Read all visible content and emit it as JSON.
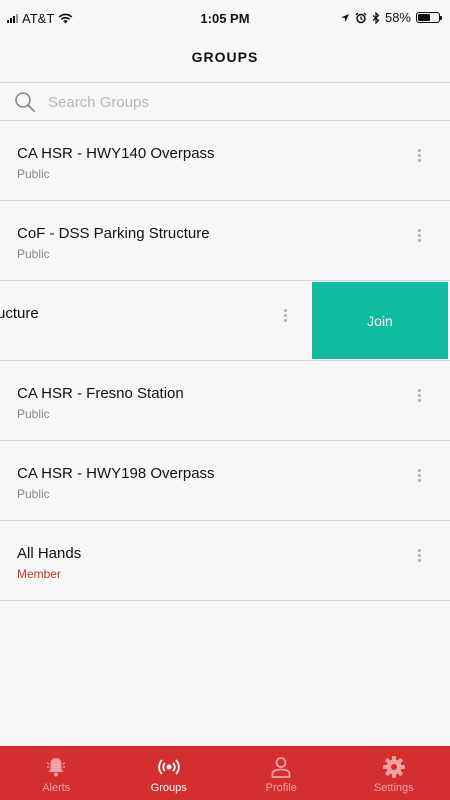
{
  "status_bar": {
    "carrier": "AT&T",
    "time": "1:05 PM",
    "battery_percent": "58%",
    "battery_level": 0.58,
    "icons": [
      "signal-icon",
      "wifi-icon",
      "location-icon",
      "alarm-icon",
      "bluetooth-icon",
      "battery-icon"
    ]
  },
  "header": {
    "title": "GROUPS"
  },
  "search": {
    "placeholder": "Search Groups",
    "value": ""
  },
  "groups": [
    {
      "name": "CA HSR - HWY140 Overpass",
      "type": "Public"
    },
    {
      "name": "CoF - DSS Parking Structure",
      "type": "Public"
    },
    {
      "name": "ructure",
      "type": "",
      "swiped": true,
      "action": "Join"
    },
    {
      "name": "CA HSR - Fresno Station",
      "type": "Public"
    },
    {
      "name": "CA HSR - HWY198 Overpass",
      "type": "Public"
    },
    {
      "name": "All Hands",
      "type": "Member"
    }
  ],
  "tabbar": {
    "tabs": [
      {
        "label": "Alerts",
        "icon": "bell-icon"
      },
      {
        "label": "Groups",
        "icon": "broadcast-icon",
        "active": true
      },
      {
        "label": "Profile",
        "icon": "person-icon"
      },
      {
        "label": "Settings",
        "icon": "gear-icon"
      }
    ]
  },
  "colors": {
    "accent": "#d42f2f",
    "join": "#12bca1",
    "member": "#c0392b"
  }
}
